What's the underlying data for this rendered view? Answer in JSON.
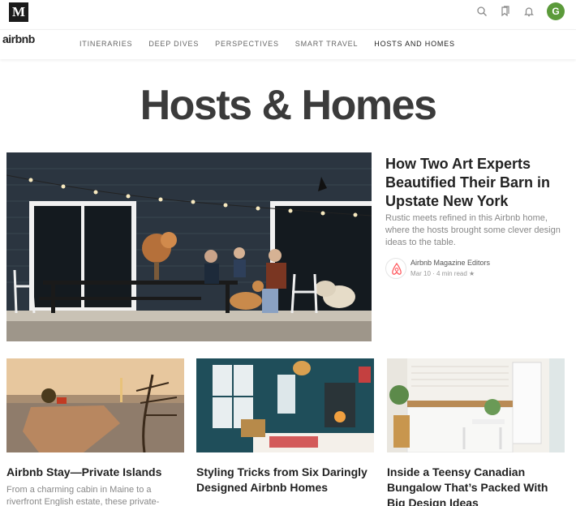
{
  "topbar": {
    "logo_letter": "M",
    "icons": [
      "search-icon",
      "bookmarks-icon",
      "notifications-icon"
    ],
    "avatar_initial": "G",
    "avatar_color": "#5b9a3a"
  },
  "nav": {
    "brand": "airbnb",
    "links": [
      "ITINERARIES",
      "DEEP DIVES",
      "PERSPECTIVES",
      "SMART TRAVEL",
      "HOSTS AND HOMES"
    ],
    "active_index": 4
  },
  "page": {
    "title": "Hosts & Homes"
  },
  "hero": {
    "title": "How Two Art Experts Beautified Their Barn in Upstate New York",
    "description": "Rustic meets refined in this Airbnb home, where the hosts brought some clever design ideas to the table.",
    "author": "Airbnb Magazine Editors",
    "meta": "Mar 10 · 4 min read ★",
    "brand_color": "#ff5a5f"
  },
  "cards": [
    {
      "title": "Airbnb Stay—Private Islands",
      "description": "From a charming cabin in Maine to a riverfront English estate, these private-"
    },
    {
      "title": "Styling Tricks from Six Daringly Designed Airbnb Homes",
      "description": ""
    },
    {
      "title": "Inside a Teensy Canadian Bungalow That’s Packed With Big Design Ideas",
      "description": ""
    }
  ]
}
